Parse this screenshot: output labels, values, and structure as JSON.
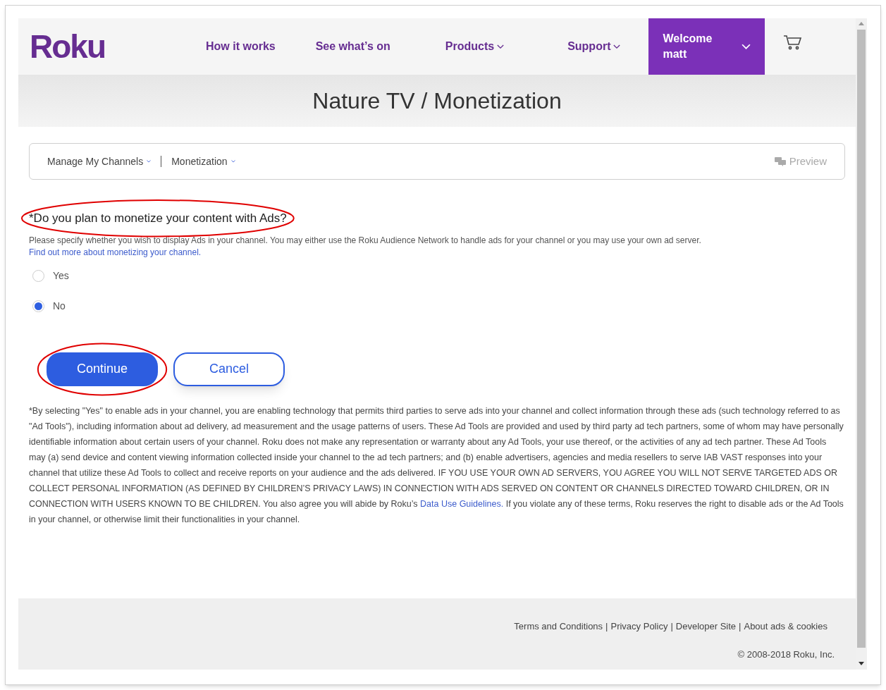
{
  "header": {
    "logo": "Roku",
    "nav": [
      {
        "label": "How it works",
        "dropdown": false
      },
      {
        "label": "See what’s on",
        "dropdown": false
      },
      {
        "label": "Products",
        "dropdown": true
      },
      {
        "label": "Support",
        "dropdown": true
      }
    ],
    "account": {
      "line1": "Welcome",
      "line2": "matt"
    }
  },
  "page_title": "Nature TV / Monetization",
  "breadcrumbs": {
    "items": [
      "Manage My Channels",
      "Monetization"
    ],
    "preview": {
      "label": "Preview",
      "disabled": true
    }
  },
  "question": {
    "title": "*Do you plan to monetize your content with Ads?",
    "highlighted": true,
    "description": "Please specify whether you wish to display Ads in your channel. You may either use the Roku Audience Network to handle ads for your channel or you may use your own ad server.",
    "link": "Find out more about monetizing your channel."
  },
  "options": [
    {
      "label": "Yes",
      "selected": false
    },
    {
      "label": "No",
      "selected": true
    }
  ],
  "buttons": [
    {
      "label": "Continue",
      "kind": "primary",
      "highlighted": true
    },
    {
      "label": "Cancel",
      "kind": "secondary",
      "highlighted": false
    }
  ],
  "disclaimer": {
    "before": "*By selecting \"Yes\" to enable ads in your channel, you are enabling technology that permits third parties to serve ads into your channel and collect information through these ads (such technology referred to as \"Ad Tools\"), including information about ad delivery, ad measurement and the usage patterns of users. These Ad Tools are provided and used by third party ad tech partners, some of whom may have personally identifiable information about certain users of your channel. Roku does not make any representation or warranty about any Ad Tools, your use thereof, or the activities of any ad tech partner. These Ad Tools may (a) send device and content viewing information collected inside your channel to the ad tech partners; and (b) enable advertisers, agencies and media resellers to serve IAB VAST responses into your channel that utilize these Ad Tools to collect and receive reports on your audience and the ads delivered. IF YOU USE YOUR OWN AD SERVERS, YOU AGREE YOU WILL NOT SERVE TARGETED ADS OR COLLECT PERSONAL INFORMATION (AS DEFINED BY CHILDREN’S PRIVACY LAWS) IN CONNECTION WITH ADS SERVED ON CONTENT OR CHANNELS DIRECTED TOWARD CHILDREN, OR IN CONNECTION WITH USERS KNOWN TO BE CHILDREN. You also agree you will abide by Roku’s",
    "link": "Data Use Guidelines.",
    "after": "If you violate any of these terms, Roku reserves the right to disable ads or the Ad Tools in your channel, or otherwise limit their functionalities in your channel."
  },
  "footer": {
    "links": [
      "Terms and Conditions",
      "Privacy Policy",
      "Developer Site",
      "About ads & cookies"
    ],
    "separator": "|",
    "copyright": "© 2008-2018 Roku, Inc."
  }
}
